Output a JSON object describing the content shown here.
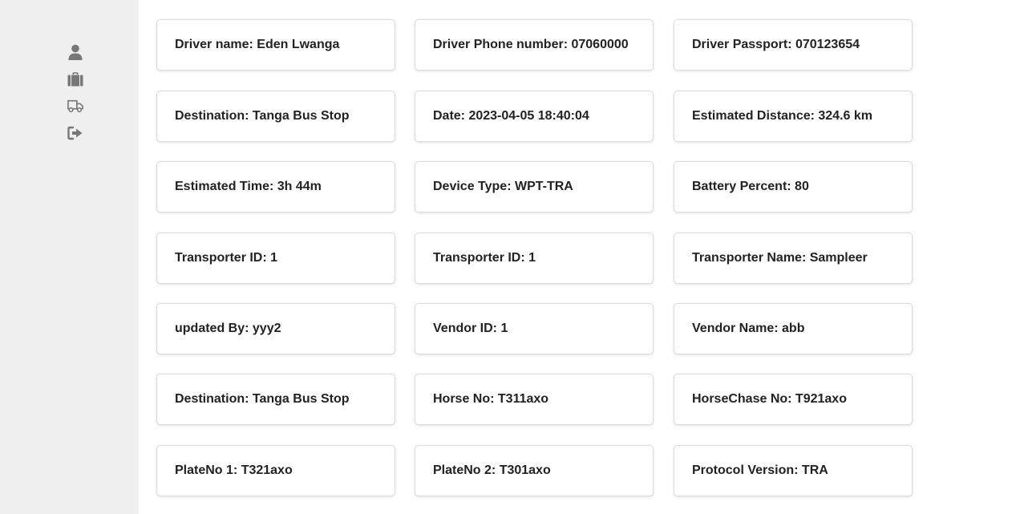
{
  "sidebar": {
    "items": [
      {
        "icon": "user-icon"
      },
      {
        "icon": "briefcase-icon"
      },
      {
        "icon": "truck-icon"
      },
      {
        "icon": "sign-out-icon"
      }
    ]
  },
  "cards": [
    "Driver name: Eden Lwanga",
    "Driver Phone number: 07060000",
    "Driver Passport: 070123654",
    "Destination: Tanga Bus Stop",
    "Date: 2023-04-05 18:40:04",
    "Estimated Distance: 324.6 km",
    "Estimated Time: 3h 44m",
    "Device Type: WPT-TRA",
    "Battery Percent: 80",
    "Transporter ID: 1",
    "Transporter ID: 1",
    "Transporter Name: Sampleer",
    "updated By: yyy2",
    "Vendor ID: 1",
    "Vendor Name: abb",
    "Destination: Tanga Bus Stop",
    "Horse No: T311axo",
    "HorseChase No: T921axo",
    "PlateNo 1: T321axo",
    "PlateNo 2: T301axo",
    "Protocol Version: TRA"
  ]
}
